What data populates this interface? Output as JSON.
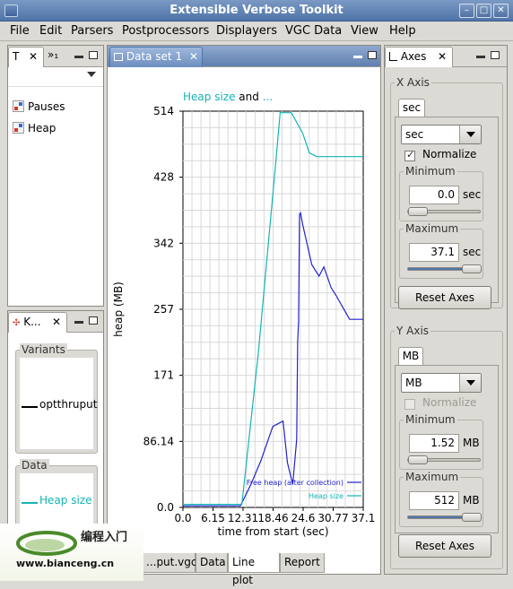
{
  "window": {
    "title": "Extensible Verbose Toolkit"
  },
  "menu": [
    "File",
    "Edit",
    "Parsers",
    "Postprocessors",
    "Displayers",
    "VGC Data",
    "View",
    "Help"
  ],
  "left_top": {
    "tab1_label": "T",
    "tab2_label": "»₁",
    "items": [
      "Pauses",
      "Heap"
    ]
  },
  "left_bottom": {
    "tab_label": "K...",
    "variants_label": "Variants",
    "variant_item": "optthruput",
    "data_label": "Data",
    "data_item": "Heap size"
  },
  "center": {
    "tab_label": "Data set 1",
    "bottom_tabs": [
      "...put.vgc",
      "Data",
      "Line plot",
      "Report"
    ],
    "active_bottom_tab": "Line plot"
  },
  "right": {
    "tab_label": "Axes",
    "x_axis": {
      "group_label": "X Axis",
      "subtab": "sec",
      "combo_value": "sec",
      "normalize_label": "Normalize",
      "normalize_checked": true,
      "minimum_label": "Minimum",
      "minimum_value": "0.0",
      "minimum_unit": "sec",
      "minimum_slider_fraction": 0.0,
      "maximum_label": "Maximum",
      "maximum_value": "37.1",
      "maximum_unit": "sec",
      "maximum_slider_fraction": 1.0,
      "reset_label": "Reset Axes"
    },
    "y_axis": {
      "group_label": "Y Axis",
      "subtab": "MB",
      "combo_value": "MB",
      "normalize_label": "Normalize",
      "normalize_checked": false,
      "minimum_label": "Minimum",
      "minimum_value": "1.52",
      "minimum_unit": "MB",
      "minimum_slider_fraction": 0.0,
      "maximum_label": "Maximum",
      "maximum_value": "512",
      "maximum_unit": "MB",
      "maximum_slider_fraction": 1.0,
      "reset_label": "Reset Axes"
    }
  },
  "watermark": {
    "cn": "编程入门",
    "url": "www.bianceng.cn"
  },
  "colors": {
    "free_heap": "#2222cc",
    "heap_size": "#14b4b4",
    "title_bar": "#5a7bb0"
  },
  "chart_data": {
    "type": "line",
    "title_parts": [
      "Heap size",
      " and ",
      "..."
    ],
    "xlabel": "time from start (sec)",
    "ylabel": "heap (MB)",
    "x_ticks": [
      "0.0",
      "6.15",
      "12.31",
      "18.46",
      "24.6",
      "30.77",
      "37.1"
    ],
    "y_ticks": [
      "0.0",
      "86.14",
      "171",
      "257",
      "342",
      "428",
      "514"
    ],
    "xlim": [
      0,
      37.1
    ],
    "ylim": [
      0,
      514
    ],
    "grid": true,
    "legend_position": "bottom-right",
    "series": [
      {
        "name": "Free heap (after collection)",
        "color": "#2222cc",
        "x": [
          0,
          11.8,
          12.3,
          14.0,
          16.0,
          18.5,
          20.6,
          21.5,
          22.6,
          23.4,
          23.6,
          23.8,
          24.0,
          24.2,
          24.6,
          26.5,
          28.0,
          29.0,
          30.5,
          31.5,
          34.3,
          35.5,
          37.1
        ],
        "y": [
          2,
          2,
          8,
          30,
          60,
          105,
          112,
          58,
          30,
          88,
          215,
          240,
          380,
          382,
          368,
          315,
          300,
          312,
          285,
          275,
          244,
          244,
          244
        ]
      },
      {
        "name": "Heap size",
        "color": "#14b4b4",
        "x": [
          0,
          12.1,
          12.4,
          15.5,
          19.0,
          20.0,
          22.3,
          24.6,
          26.0,
          27.5,
          37.1
        ],
        "y": [
          4,
          4,
          20,
          200,
          440,
          512,
          512,
          486,
          460,
          455,
          455
        ]
      }
    ]
  }
}
